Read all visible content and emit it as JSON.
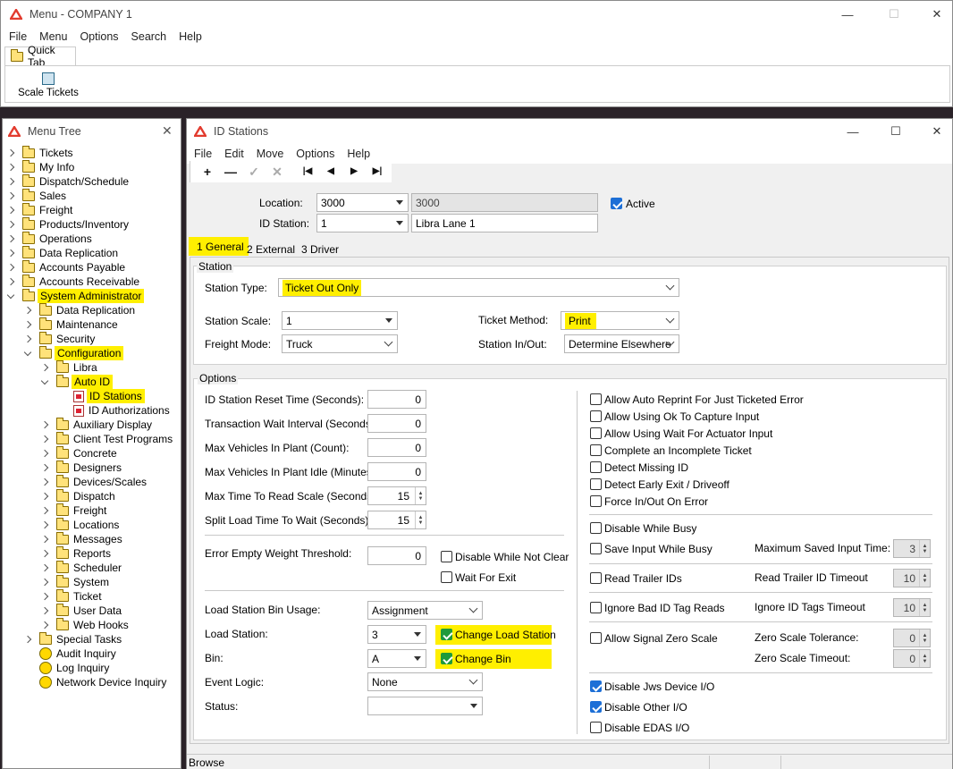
{
  "main_window": {
    "title": "Menu - COMPANY 1",
    "menu": [
      "File",
      "Menu",
      "Options",
      "Search",
      "Help"
    ],
    "quick_tab": "Quick Tab",
    "scale_tickets": "Scale Tickets"
  },
  "menu_tree": {
    "title": "Menu Tree",
    "items": [
      {
        "label": "Tickets",
        "level": 0,
        "icon": "folder-icon",
        "arrow": "closed"
      },
      {
        "label": "My Info",
        "level": 0,
        "icon": "folder-icon",
        "arrow": "closed"
      },
      {
        "label": "Dispatch/Schedule",
        "level": 0,
        "icon": "folder-icon",
        "arrow": "closed"
      },
      {
        "label": "Sales",
        "level": 0,
        "icon": "folder-icon",
        "arrow": "closed"
      },
      {
        "label": "Freight",
        "level": 0,
        "icon": "folder-icon",
        "arrow": "closed"
      },
      {
        "label": "Products/Inventory",
        "level": 0,
        "icon": "folder-icon",
        "arrow": "closed"
      },
      {
        "label": "Operations",
        "level": 0,
        "icon": "folder-icon",
        "arrow": "closed"
      },
      {
        "label": "Data Replication",
        "level": 0,
        "icon": "folder-icon",
        "arrow": "closed"
      },
      {
        "label": "Accounts Payable",
        "level": 0,
        "icon": "folder-icon",
        "arrow": "closed"
      },
      {
        "label": "Accounts Receivable",
        "level": 0,
        "icon": "folder-icon",
        "arrow": "closed"
      },
      {
        "label": "System Administrator",
        "level": 0,
        "icon": "folder-open-icon",
        "arrow": "open",
        "highlight": true
      },
      {
        "label": "Data Replication",
        "level": 1,
        "icon": "folder-icon",
        "arrow": "closed"
      },
      {
        "label": "Maintenance",
        "level": 1,
        "icon": "folder-icon",
        "arrow": "closed"
      },
      {
        "label": "Security",
        "level": 1,
        "icon": "folder-icon",
        "arrow": "closed"
      },
      {
        "label": "Configuration",
        "level": 1,
        "icon": "folder-open-icon",
        "arrow": "open",
        "highlight": true
      },
      {
        "label": "Libra",
        "level": 2,
        "icon": "folder-icon",
        "arrow": "closed"
      },
      {
        "label": "Auto ID",
        "level": 2,
        "icon": "folder-open-icon",
        "arrow": "open",
        "highlight": true
      },
      {
        "label": "ID Stations",
        "level": 3,
        "icon": "form-icon",
        "arrow": "none",
        "highlight": true
      },
      {
        "label": "ID Authorizations",
        "level": 3,
        "icon": "form-icon",
        "arrow": "none"
      },
      {
        "label": "Auxiliary Display",
        "level": 2,
        "icon": "folder-icon",
        "arrow": "closed"
      },
      {
        "label": "Client Test Programs",
        "level": 2,
        "icon": "folder-icon",
        "arrow": "closed"
      },
      {
        "label": "Concrete",
        "level": 2,
        "icon": "folder-icon",
        "arrow": "closed"
      },
      {
        "label": "Designers",
        "level": 2,
        "icon": "folder-icon",
        "arrow": "closed"
      },
      {
        "label": "Devices/Scales",
        "level": 2,
        "icon": "folder-icon",
        "arrow": "closed"
      },
      {
        "label": "Dispatch",
        "level": 2,
        "icon": "folder-icon",
        "arrow": "closed"
      },
      {
        "label": "Freight",
        "level": 2,
        "icon": "folder-icon",
        "arrow": "closed"
      },
      {
        "label": "Locations",
        "level": 2,
        "icon": "folder-icon",
        "arrow": "closed"
      },
      {
        "label": "Messages",
        "level": 2,
        "icon": "folder-icon",
        "arrow": "closed"
      },
      {
        "label": "Reports",
        "level": 2,
        "icon": "folder-icon",
        "arrow": "closed"
      },
      {
        "label": "Scheduler",
        "level": 2,
        "icon": "folder-icon",
        "arrow": "closed"
      },
      {
        "label": "System",
        "level": 2,
        "icon": "folder-icon",
        "arrow": "closed"
      },
      {
        "label": "Ticket",
        "level": 2,
        "icon": "folder-icon",
        "arrow": "closed"
      },
      {
        "label": "User Data",
        "level": 2,
        "icon": "folder-icon",
        "arrow": "closed"
      },
      {
        "label": "Web Hooks",
        "level": 2,
        "icon": "folder-icon",
        "arrow": "closed"
      },
      {
        "label": "Special Tasks",
        "level": 1,
        "icon": "folder-icon",
        "arrow": "closed"
      },
      {
        "label": "Audit Inquiry",
        "level": 1,
        "icon": "inquiry-icon",
        "arrow": "none"
      },
      {
        "label": "Log Inquiry",
        "level": 1,
        "icon": "inquiry-icon",
        "arrow": "none"
      },
      {
        "label": "Network Device Inquiry",
        "level": 1,
        "icon": "inquiry-icon",
        "arrow": "none"
      }
    ]
  },
  "id_stations": {
    "title": "ID Stations",
    "menu": [
      "File",
      "Edit",
      "Move",
      "Options",
      "Help"
    ],
    "location_label": "Location:",
    "location_value": "3000",
    "location_desc": "3000",
    "station_label": "ID Station:",
    "station_value": "1",
    "station_desc": "Libra Lane 1",
    "active_label": "Active",
    "tabs": [
      "1 General",
      "2 External",
      "3 Driver"
    ],
    "station_group": "Station",
    "station_type_label": "Station Type:",
    "station_type_value": "Ticket Out Only",
    "station_scale_label": "Station Scale:",
    "station_scale_value": "1",
    "freight_mode_label": "Freight Mode:",
    "freight_mode_value": "Truck",
    "ticket_method_label": "Ticket Method:",
    "ticket_method_value": "Print",
    "station_inout_label": "Station In/Out:",
    "station_inout_value": "Determine Elsewhere",
    "options_group": "Options",
    "numeric": [
      {
        "label": "ID Station Reset Time (Seconds):",
        "value": "0"
      },
      {
        "label": "Transaction Wait Interval  (Seconds):",
        "value": "0"
      },
      {
        "label": "Max Vehicles In Plant (Count):",
        "value": "0"
      },
      {
        "label": "Max Vehicles In Plant Idle (Minutes):",
        "value": "0"
      },
      {
        "label": "Max Time To Read Scale (Seconds):",
        "value": "15"
      },
      {
        "label": "Split Load Time To Wait (Seconds):",
        "value": "15"
      }
    ],
    "error_threshold_label": "Error Empty Weight Threshold:",
    "error_threshold_value": "0",
    "disable_not_clear": "Disable While Not Clear",
    "wait_for_exit": "Wait For Exit",
    "bin_usage_label": "Load Station Bin Usage:",
    "bin_usage_value": "Assignment",
    "load_station_label": "Load Station:",
    "load_station_value": "3",
    "change_load_station": "Change Load Station",
    "bin_label": "Bin:",
    "bin_value": "A",
    "change_bin": "Change Bin",
    "event_logic_label": "Event Logic:",
    "event_logic_value": "None",
    "status_label": "Status:",
    "status_value": "",
    "right_checks": [
      "Allow Auto Reprint For Just Ticketed Error",
      "Allow Using Ok To Capture Input",
      "Allow Using Wait For Actuator Input",
      "Complete an Incomplete Ticket",
      "Detect Missing ID",
      "Detect Early Exit / Driveoff",
      "Force In/Out On Error"
    ],
    "disable_while_busy": "Disable While Busy",
    "save_input_busy": "Save Input While Busy",
    "max_saved_label": "Maximum Saved Input Time:",
    "max_saved_value": "3",
    "read_trailer": "Read Trailer IDs",
    "read_trailer_timeout_label": "Read Trailer ID Timeout",
    "read_trailer_timeout_value": "10",
    "ignore_bad": "Ignore Bad ID Tag Reads",
    "ignore_timeout_label": "Ignore ID Tags Timeout",
    "ignore_timeout_value": "10",
    "allow_signal_zero": "Allow Signal Zero Scale",
    "zero_tol_label": "Zero Scale Tolerance:",
    "zero_tol_value": "0",
    "zero_timeout_label": "Zero Scale Timeout:",
    "zero_timeout_value": "0",
    "disable_jws": "Disable Jws Device I/O",
    "disable_other": "Disable Other I/O",
    "disable_edas": "Disable EDAS I/O",
    "status_bar": "Browse"
  },
  "colors": {
    "highlight": "#ffef00",
    "accent": "#1d6fd6",
    "brand": "#e23b2e"
  }
}
